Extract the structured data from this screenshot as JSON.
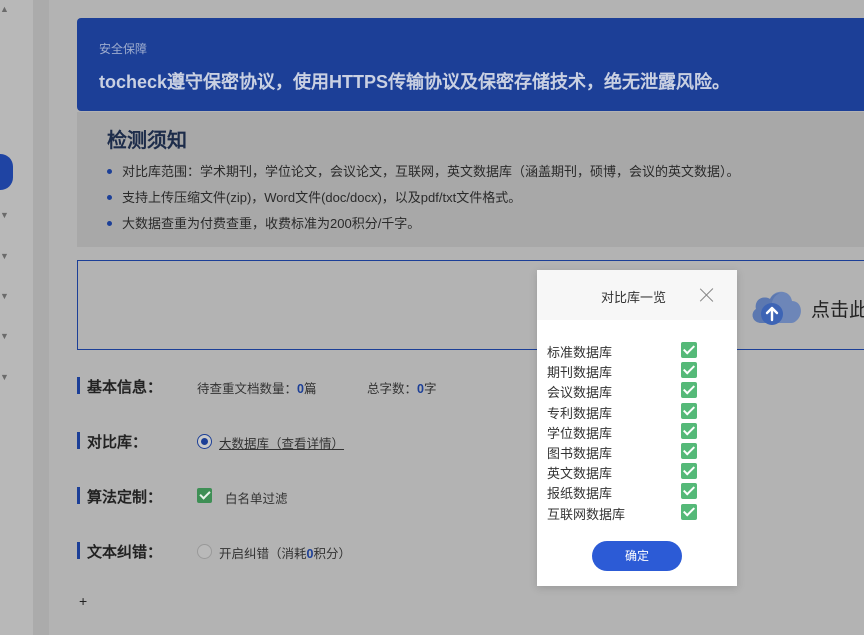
{
  "security": {
    "title": "安全保障",
    "text": "tocheck遵守保密协议，使用HTTPS传输协议及保密存储技术，绝无泄露风险。"
  },
  "notice": {
    "title": "检测须知",
    "items": [
      "对比库范围：学术期刊，学位论文，会议论文，互联网，英文数据库（涵盖期刊，硕博，会议的英文数据）。",
      "支持上传压缩文件(zip)，Word文件(doc/docx)，以及pdf/txt文件格式。",
      "大数据查重为付费查重，收费标准为200积分/千字。"
    ]
  },
  "upload": {
    "label": "点击此"
  },
  "basic_info": {
    "label": "基本信息：",
    "doc_count_label": "待查重文档数量：",
    "doc_count": "0",
    "doc_count_unit": "篇",
    "word_count_label": "总字数：",
    "word_count": "0",
    "word_count_unit": "字"
  },
  "compare_db": {
    "label": "对比库：",
    "option": "大数据库（查看详情）"
  },
  "algorithm": {
    "label": "算法定制：",
    "option": "白名单过滤"
  },
  "text_correction": {
    "label": "文本纠错：",
    "option_prefix": "开启纠错（消耗",
    "option_num": "0",
    "option_suffix": "积分）"
  },
  "plus_label": "+",
  "modal": {
    "title": "对比库一览",
    "databases": [
      "标准数据库",
      "期刊数据库",
      "会议数据库",
      "专利数据库",
      "学位数据库",
      "图书数据库",
      "英文数据库",
      "报纸数据库",
      "互联网数据库"
    ],
    "confirm_label": "确定"
  },
  "colors": {
    "brand_blue": "#1c3f97",
    "confirm_blue": "#2c5bd6",
    "check_green": "#55b978"
  },
  "icons": {
    "upload": "cloud-upload-icon",
    "close": "close-icon",
    "check": "check-icon"
  }
}
